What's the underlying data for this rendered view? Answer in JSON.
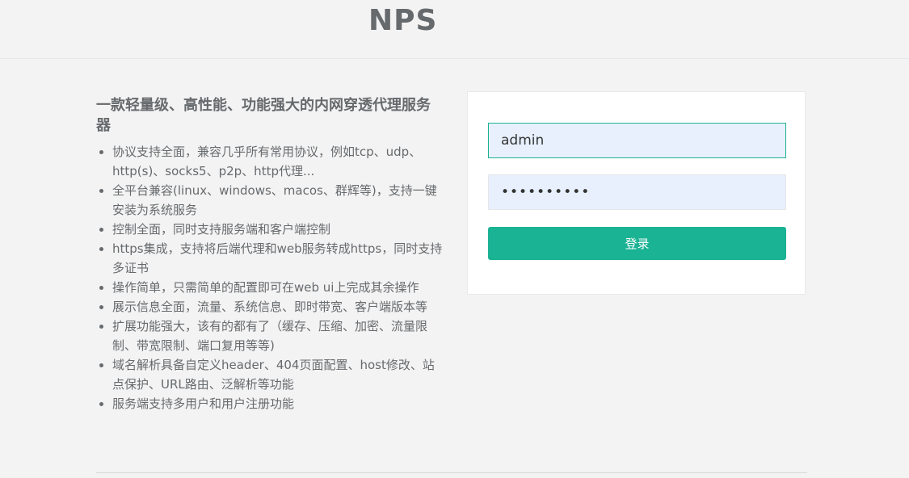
{
  "header": {
    "logo": "NPS"
  },
  "intro": {
    "title": "一款轻量级、高性能、功能强大的内网穿透代理服务器",
    "features": [
      "协议支持全面，兼容几乎所有常用协议，例如tcp、udp、http(s)、socks5、p2p、http代理...",
      "全平台兼容(linux、windows、macos、群辉等)，支持一键安装为系统服务",
      "控制全面，同时支持服务端和客户端控制",
      "https集成，支持将后端代理和web服务转成https，同时支持多证书",
      "操作简单，只需简单的配置即可在web ui上完成其余操作",
      "展示信息全面，流量、系统信息、即时带宽、客户端版本等",
      "扩展功能强大，该有的都有了（缓存、压缩、加密、流量限制、带宽限制、端口复用等等)",
      "域名解析具备自定义header、404页面配置、host修改、站点保护、URL路由、泛解析等功能",
      "服务端支持多用户和用户注册功能"
    ]
  },
  "login": {
    "username_value": "admin",
    "password_value": "••••••••••",
    "submit_label": "登录"
  },
  "colors": {
    "accent": "#1ab394",
    "input_bg": "#e8f0fe",
    "page_bg": "#f3f3f4",
    "text": "#676a6c"
  }
}
